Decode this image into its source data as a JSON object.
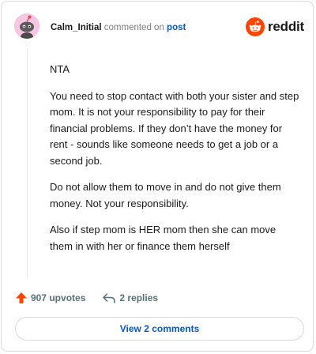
{
  "header": {
    "username": "Calm_Initial",
    "commented_on": "commented on",
    "post_link": "post",
    "brand": "reddit"
  },
  "comment": {
    "paragraphs": [
      "NTA",
      "You need to stop contact with both your sister and step mom. It is not your responsibility to pay for their financial problems. If they don’t have the money for rent - sounds like someone needs to get a job or a second job.",
      "Do not allow them to move in and do not give them money. Not your responsibility.",
      "Also if step mom is HER mom then she can move them in with her or finance them herself"
    ]
  },
  "footer": {
    "upvotes_label": "907 upvotes",
    "replies_label": "2 replies",
    "view_comments_label": "View 2 comments"
  },
  "icons": {
    "avatar": "snoo-avatar-icon",
    "logo": "reddit-snoo-icon",
    "upvote": "upvote-arrow-icon",
    "reply": "reply-arrow-icon"
  },
  "colors": {
    "brand_orange": "#ff4500",
    "link_blue": "#0a58b4",
    "avatar_bg": "#f7c6e3",
    "muted_text": "#576f76"
  }
}
